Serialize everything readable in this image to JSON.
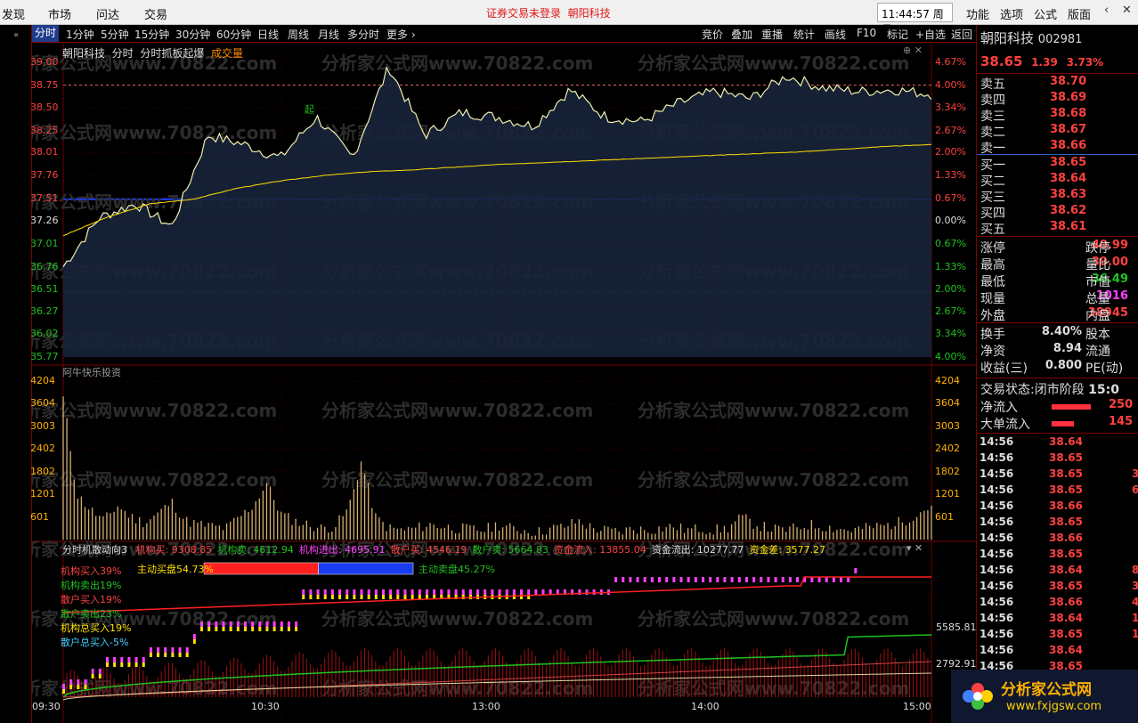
{
  "menu": {
    "left": [
      "发现",
      "市场",
      "问达",
      "交易"
    ],
    "notice": "证券交易未登录",
    "stock_link": "朝阳科技",
    "clock": "11:44:57 周日",
    "right": [
      "功能",
      "选项",
      "公式",
      "版面"
    ]
  },
  "toolbar": {
    "periods": [
      "分时",
      "1分钟",
      "5分钟",
      "15分钟",
      "30分钟",
      "60分钟",
      "日线",
      "周线",
      "月线",
      "多分时",
      "更多 ›"
    ],
    "actions": [
      "竞价",
      "叠加",
      "重播",
      "统计",
      "画线",
      "F10",
      "标记",
      "+自选",
      "返回"
    ]
  },
  "chart_header": {
    "name": "朝阳科技",
    "sub1": "分时",
    "sub2": "分时抓板起爆",
    "sub3": "成交量"
  },
  "watermark": "分析家公式网www.70822.com",
  "price_axis": {
    "left": [
      "39.00",
      "38.75",
      "38.50",
      "38.25",
      "38.01",
      "37.76",
      "37.51",
      "37.26",
      "37.01",
      "36.76",
      "36.51",
      "36.27",
      "36.02",
      "35.77"
    ],
    "right": [
      "4.67%",
      "4.00%",
      "3.34%",
      "2.67%",
      "2.00%",
      "1.33%",
      "0.67%",
      "0.00%",
      "0.67%",
      "1.33%",
      "2.00%",
      "2.67%",
      "3.34%",
      "4.00%"
    ]
  },
  "chart_data": [
    {
      "type": "line",
      "title": "分时",
      "x": [
        "09:30",
        "10:30",
        "13:00",
        "14:00",
        "15:00"
      ],
      "series": [
        {
          "name": "price",
          "values": [
            36.76,
            37.3,
            37.45,
            37.2,
            38.2,
            38.1,
            37.95,
            38.4,
            37.95,
            38.95,
            38.2,
            38.45,
            38.4,
            38.3,
            38.7,
            38.4,
            38.35,
            38.55,
            38.68,
            38.6,
            38.85,
            38.72,
            38.68,
            38.7,
            38.65
          ]
        },
        {
          "name": "avg",
          "values": [
            37.1,
            37.3,
            37.45,
            37.5,
            37.62,
            37.7,
            37.76,
            37.8,
            37.82,
            37.85,
            37.88,
            37.9,
            37.92,
            37.94,
            37.96,
            37.98,
            38.0,
            38.02,
            38.05,
            38.08,
            38.1
          ]
        }
      ],
      "ylim": [
        35.77,
        39.0
      ],
      "annotation": "起"
    },
    {
      "type": "bar",
      "title": "成交量",
      "ylim": [
        0,
        4204
      ],
      "yticks": [
        "4204",
        "3604",
        "3003",
        "2402",
        "1802",
        "1201",
        "601"
      ],
      "values": [
        3800,
        1200,
        800,
        500,
        900,
        600,
        450,
        700,
        1000,
        500,
        400,
        350,
        300,
        600,
        900,
        1500,
        700,
        500,
        400,
        300,
        350,
        800,
        2100,
        600,
        300,
        250,
        300,
        400,
        350,
        300,
        280,
        250,
        400,
        300,
        250,
        200,
        300,
        350,
        500,
        300,
        250,
        200,
        300,
        250,
        300,
        350,
        250,
        300,
        250,
        300,
        600,
        400,
        300,
        250,
        300,
        400,
        350,
        300,
        250,
        300,
        350,
        400,
        500,
        700,
        900
      ]
    }
  ],
  "vol_label": "阿牛快乐投资",
  "indicator": {
    "name": "分时机散动向3",
    "items": [
      {
        "label": "机构买:",
        "value": "9308.85",
        "color": "#ff4040"
      },
      {
        "label": "机构卖:",
        "value": "4612.94",
        "color": "#20c020"
      },
      {
        "label": "机构进出:",
        "value": "4695.91",
        "color": "#ff40ff"
      },
      {
        "label": "散户买:",
        "value": "4546.19",
        "color": "#ff4040"
      },
      {
        "label": "散户卖:",
        "value": "5664.83",
        "color": "#20c020"
      },
      {
        "label": "资金流入:",
        "value": "13855.04",
        "color": "#ff4040"
      },
      {
        "label": "资金流出:",
        "value": "10277.77",
        "color": "#ddd"
      },
      {
        "label": "资金差:",
        "value": "3577.27",
        "color": "#ffe000"
      }
    ],
    "legend": [
      {
        "text": "机构买入39%",
        "color": "#ff4040"
      },
      {
        "text": "机构卖出19%",
        "color": "#20c020"
      },
      {
        "text": "散户买入19%",
        "color": "#ff4040"
      },
      {
        "text": "散户卖出23%",
        "color": "#20c020"
      },
      {
        "text": "机构总买入19%",
        "color": "#ffe000"
      },
      {
        "text": "散户总买入-5%",
        "color": "#40d0ff"
      }
    ],
    "buy_bar": "主动买盘54.73%",
    "sell_bar": "主动卖盘45.27%",
    "buy_pct": 54.73,
    "axis_top": "5585.81",
    "axis_bot": "2792.91"
  },
  "time_axis": [
    "09:30",
    "10:30",
    "13:00",
    "14:00",
    "15:00"
  ],
  "quote": {
    "name": "朝阳科技",
    "code": "002981",
    "price": "38.65",
    "change": "1.39",
    "pct": "3.73%",
    "asks": [
      {
        "label": "卖五",
        "price": "38.70"
      },
      {
        "label": "卖四",
        "price": "38.69"
      },
      {
        "label": "卖三",
        "price": "38.68"
      },
      {
        "label": "卖二",
        "price": "38.67"
      },
      {
        "label": "卖一",
        "price": "38.66"
      }
    ],
    "bids": [
      {
        "label": "买一",
        "price": "38.65"
      },
      {
        "label": "买二",
        "price": "38.64"
      },
      {
        "label": "买三",
        "price": "38.63"
      },
      {
        "label": "买四",
        "price": "38.62"
      },
      {
        "label": "买五",
        "price": "38.61"
      }
    ],
    "stats": [
      {
        "label": "涨停",
        "value": "40.99",
        "color": "#ff4040",
        "label2": "跌停"
      },
      {
        "label": "最高",
        "value": "39.00",
        "color": "#ff4040",
        "label2": "量比"
      },
      {
        "label": "最低",
        "value": "36.49",
        "color": "#20c020",
        "label2": "市值"
      },
      {
        "label": "现量",
        "value": "1016",
        "color": "#ff40ff",
        "label2": "总量"
      },
      {
        "label": "外盘",
        "value": "38945",
        "color": "#ff4040",
        "label2": "内盘"
      }
    ],
    "stats2": [
      {
        "label": "换手",
        "value": "8.40%",
        "label2": "股本"
      },
      {
        "label": "净资",
        "value": "8.94",
        "label2": "流通"
      },
      {
        "label": "收益(三)",
        "value": "0.800",
        "label2": "PE(动)"
      }
    ],
    "status_label": "交易状态:",
    "status_value": "闭市阶段",
    "status_time": "15:0",
    "flows": [
      {
        "label": "净流入",
        "value": "250",
        "bar": 0.85
      },
      {
        "label": "大单流入",
        "value": "145",
        "bar": 0.49
      }
    ],
    "ticks": [
      {
        "t": "14:56",
        "p": "38.64",
        "v": "",
        "c": "#ff4040"
      },
      {
        "t": "14:56",
        "p": "38.65",
        "v": "",
        "c": "#ff4040"
      },
      {
        "t": "14:56",
        "p": "38.65",
        "v": "3",
        "c": "#ff4040"
      },
      {
        "t": "14:56",
        "p": "38.65",
        "v": "6",
        "c": "#ff4040"
      },
      {
        "t": "14:56",
        "p": "38.66",
        "v": "",
        "c": "#ff4040"
      },
      {
        "t": "14:56",
        "p": "38.65",
        "v": "",
        "c": "#ff4040"
      },
      {
        "t": "14:56",
        "p": "38.66",
        "v": "",
        "c": "#ff4040"
      },
      {
        "t": "14:56",
        "p": "38.65",
        "v": "",
        "c": "#ff4040"
      },
      {
        "t": "14:56",
        "p": "38.64",
        "v": "8",
        "c": "#ff4040"
      },
      {
        "t": "14:56",
        "p": "38.65",
        "v": "3",
        "c": "#ff4040"
      },
      {
        "t": "14:56",
        "p": "38.66",
        "v": "4",
        "c": "#ff4040"
      },
      {
        "t": "14:56",
        "p": "38.64",
        "v": "1",
        "c": "#ff4040"
      },
      {
        "t": "14:56",
        "p": "38.65",
        "v": "1",
        "c": "#ff4040"
      },
      {
        "t": "14:56",
        "p": "38.64",
        "v": "",
        "c": "#ff4040"
      },
      {
        "t": "14:56",
        "p": "38.65",
        "v": "",
        "c": "#ff4040"
      }
    ]
  },
  "logo": {
    "text": "分析家公式网",
    "url": "www.fxjgsw.com"
  }
}
